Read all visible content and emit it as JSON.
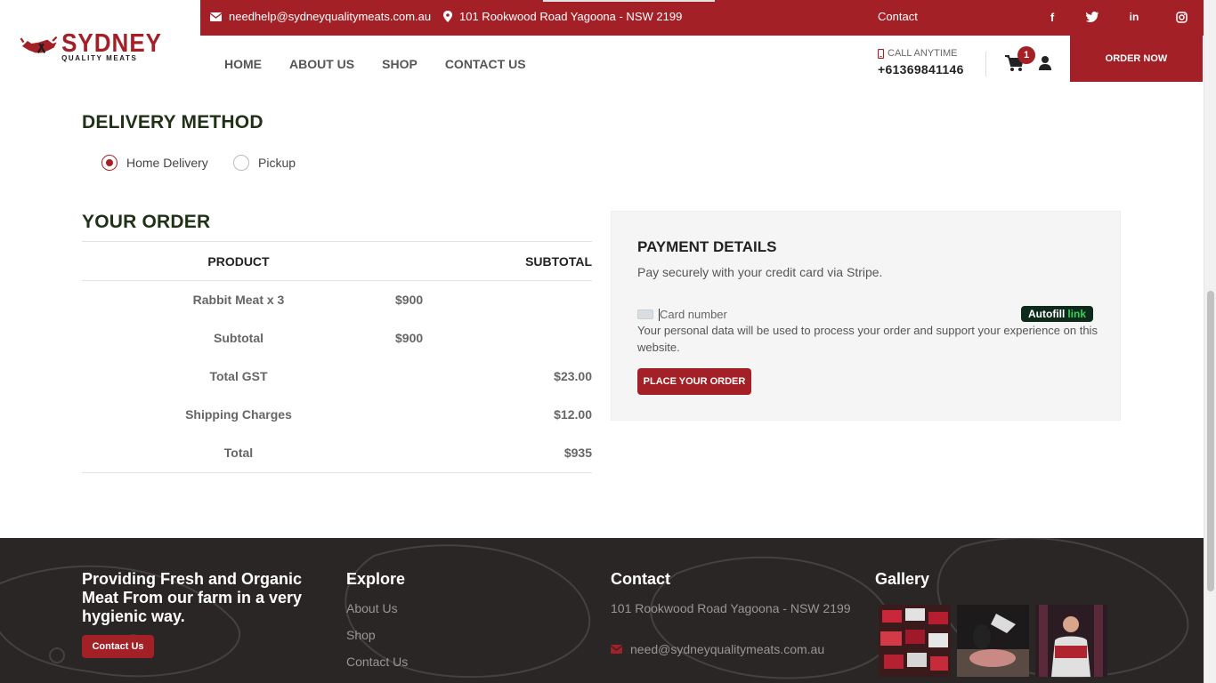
{
  "brand": {
    "name_top": "SYDNEY",
    "name_bottom": "QUALITY MEATS"
  },
  "topbar": {
    "email": "needhelp@sydneyqualitymeats.com.au",
    "address": "101 Rookwood Road Yagoona - NSW 2199",
    "contact_label": "Contact",
    "social_icons": [
      "facebook-icon",
      "twitter-icon",
      "linkedin-icon",
      "instagram-icon"
    ]
  },
  "nav": {
    "items": [
      "HOME",
      "ABOUT US",
      "SHOP",
      "CONTACT US"
    ]
  },
  "header_right": {
    "call_label": "CALL ANYTIME",
    "phone": "+61369841146",
    "cart_count": "1",
    "order_now": "ORDER NOW"
  },
  "delivery": {
    "title": "DELIVERY METHOD",
    "options": [
      {
        "label": "Home Delivery",
        "selected": true
      },
      {
        "label": "Pickup",
        "selected": false
      }
    ]
  },
  "order": {
    "title": "YOUR ORDER",
    "headers": {
      "product": "PRODUCT",
      "subtotal": "SUBTOTAL"
    },
    "rows": [
      {
        "label": "Rabbit Meat x 3",
        "mid": "$900",
        "right": ""
      },
      {
        "label": "Subtotal",
        "mid": "$900",
        "right": ""
      },
      {
        "label": "Total GST",
        "mid": "",
        "right": "$23.00"
      },
      {
        "label": "Shipping Charges",
        "mid": "",
        "right": "$12.00"
      },
      {
        "label": "Total",
        "mid": "",
        "right": "$935"
      }
    ]
  },
  "payment": {
    "title": "PAYMENT DETAILS",
    "subtitle": "Pay securely with your credit card via Stripe.",
    "card_placeholder": "Card number",
    "autofill": "Autofill",
    "autofill_link": "link",
    "privacy": "Your personal data will be used to process your order and support your experience on this website.",
    "place_order": "PLACE YOUR ORDER"
  },
  "footer": {
    "tagline": "Providing Fresh and Organic Meat From our farm in a very hygienic way.",
    "contact_btn": "Contact Us",
    "explore": {
      "title": "Explore",
      "links": [
        "About Us",
        "Shop",
        "Contact Us"
      ]
    },
    "contact": {
      "title": "Contact",
      "address": "101 Rookwood Road Yagoona - NSW 2199",
      "email": "need@sydneyqualitymeats.com.au"
    },
    "gallery": {
      "title": "Gallery"
    }
  },
  "colors": {
    "brand_red": "#a32126",
    "heading_green": "#1f3116",
    "footer_bg": "#2a2625"
  }
}
